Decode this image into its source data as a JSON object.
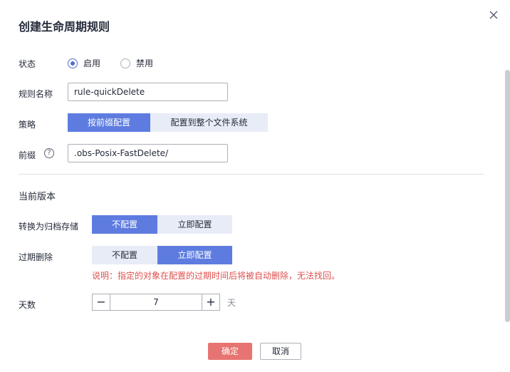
{
  "dialog": {
    "title": "创建生命周期规则",
    "close_icon": "close-icon"
  },
  "form": {
    "status": {
      "label": "状态",
      "options": [
        "启用",
        "禁用"
      ],
      "selected": "启用"
    },
    "rule_name": {
      "label": "规则名称",
      "value": "rule-quickDelete"
    },
    "policy": {
      "label": "策略",
      "options": [
        "按前缀配置",
        "配置到整个文件系统"
      ],
      "selected": "按前缀配置"
    },
    "prefix": {
      "label": "前缀",
      "help_icon": "question-circle-icon",
      "help_glyph": "?",
      "value": ".obs-Posix-FastDelete/"
    }
  },
  "current_version": {
    "heading": "当前版本",
    "archive": {
      "label": "转换为归档存储",
      "options": [
        "不配置",
        "立即配置"
      ],
      "selected": "不配置"
    },
    "expire": {
      "label": "过期删除",
      "options": [
        "不配置",
        "立即配置"
      ],
      "selected": "立即配置",
      "note": "说明：指定的对象在配置的过期时间后将被自动删除，无法找回。"
    },
    "days": {
      "label": "天数",
      "value": "7",
      "unit": "天",
      "minus": "−",
      "plus": "+"
    }
  },
  "footer": {
    "confirm_label": "确定",
    "cancel_label": "取消"
  },
  "colors": {
    "accent": "#5e7ce0",
    "danger_button": "#e77472",
    "note_text": "#de504e"
  }
}
